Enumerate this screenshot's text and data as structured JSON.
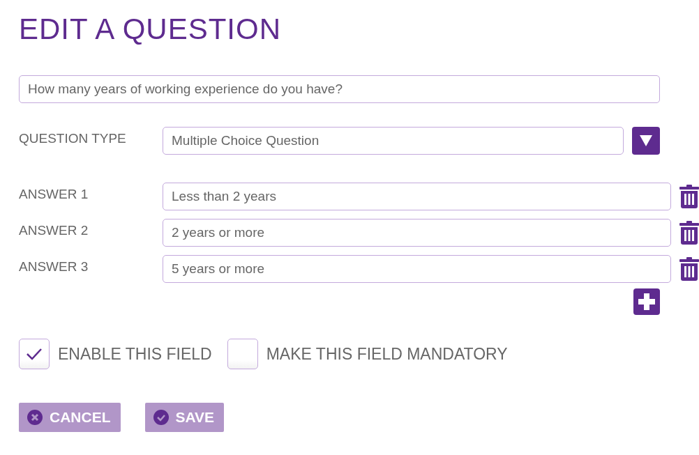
{
  "title": "EDIT A QUESTION",
  "question": {
    "value": "How many years of working experience do you have?"
  },
  "question_type": {
    "label": "QUESTION TYPE",
    "value": "Multiple Choice Question"
  },
  "answers": [
    {
      "label": "ANSWER 1",
      "value": "Less than 2 years"
    },
    {
      "label": "ANSWER 2",
      "value": "2 years or more"
    },
    {
      "label": "ANSWER 3",
      "value": "5 years or more"
    }
  ],
  "options": [
    {
      "label": "ENABLE THIS FIELD",
      "checked": true
    },
    {
      "label": "MAKE THIS FIELD MANDATORY",
      "checked": false
    }
  ],
  "buttons": [
    {
      "kind": "cancel",
      "label": "CANCEL"
    },
    {
      "kind": "save",
      "label": "SAVE"
    }
  ]
}
